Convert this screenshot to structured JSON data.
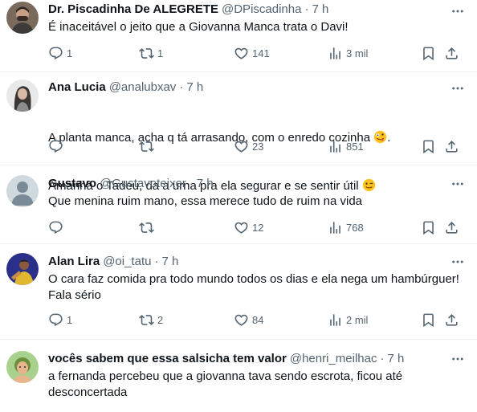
{
  "tweets": [
    {
      "name": "Dr. Piscadinha De ALEGRETE",
      "handle": "@DPiscadinha",
      "time": "7 h",
      "text": "É inaceitável o jeito que a Giovanna Manca trata o Davi!",
      "replies": "1",
      "retweets": "1",
      "likes": "141",
      "views": "3 mil"
    },
    {
      "name": "Ana Lucia",
      "handle": "@analubxav",
      "time": "7 h",
      "text_line1": "A planta manca, acha q tá arrasando, com o enredo cozinha",
      "text_line2_pre": "Amanhã o Tadeu, da a urna pra ela segurar e se sentir útil",
      "replies": "",
      "retweets": "",
      "likes": "23",
      "views": "851"
    },
    {
      "name": "Gustavo",
      "handle": "@Gustavoteixer",
      "time": "7 h",
      "text": "Que menina ruim mano, essa merece tudo de ruim na vida",
      "replies": "",
      "retweets": "",
      "likes": "12",
      "views": "768"
    },
    {
      "name": "Alan Lira",
      "handle": "@oi_tatu",
      "time": "7 h",
      "text": "O cara faz comida pra todo mundo todos os dias e ela nega um hambúrguer!\nFala sério",
      "replies": "1",
      "retweets": "2",
      "likes": "84",
      "views": "2 mil"
    },
    {
      "name": "vocês sabem que essa salsicha tem valor",
      "handle": "@henri_meilhac",
      "time": "7 h",
      "text": "a fernanda percebeu que a giovanna tava sendo escrota, ficou até\ndesconcertada"
    }
  ],
  "colors": {
    "text": "#0f1419",
    "secondary": "#536471",
    "divider": "#eff3f4"
  },
  "icons": [
    "reply-icon",
    "retweet-icon",
    "like-icon",
    "views-icon",
    "bookmark-icon",
    "share-icon",
    "more-icon"
  ]
}
